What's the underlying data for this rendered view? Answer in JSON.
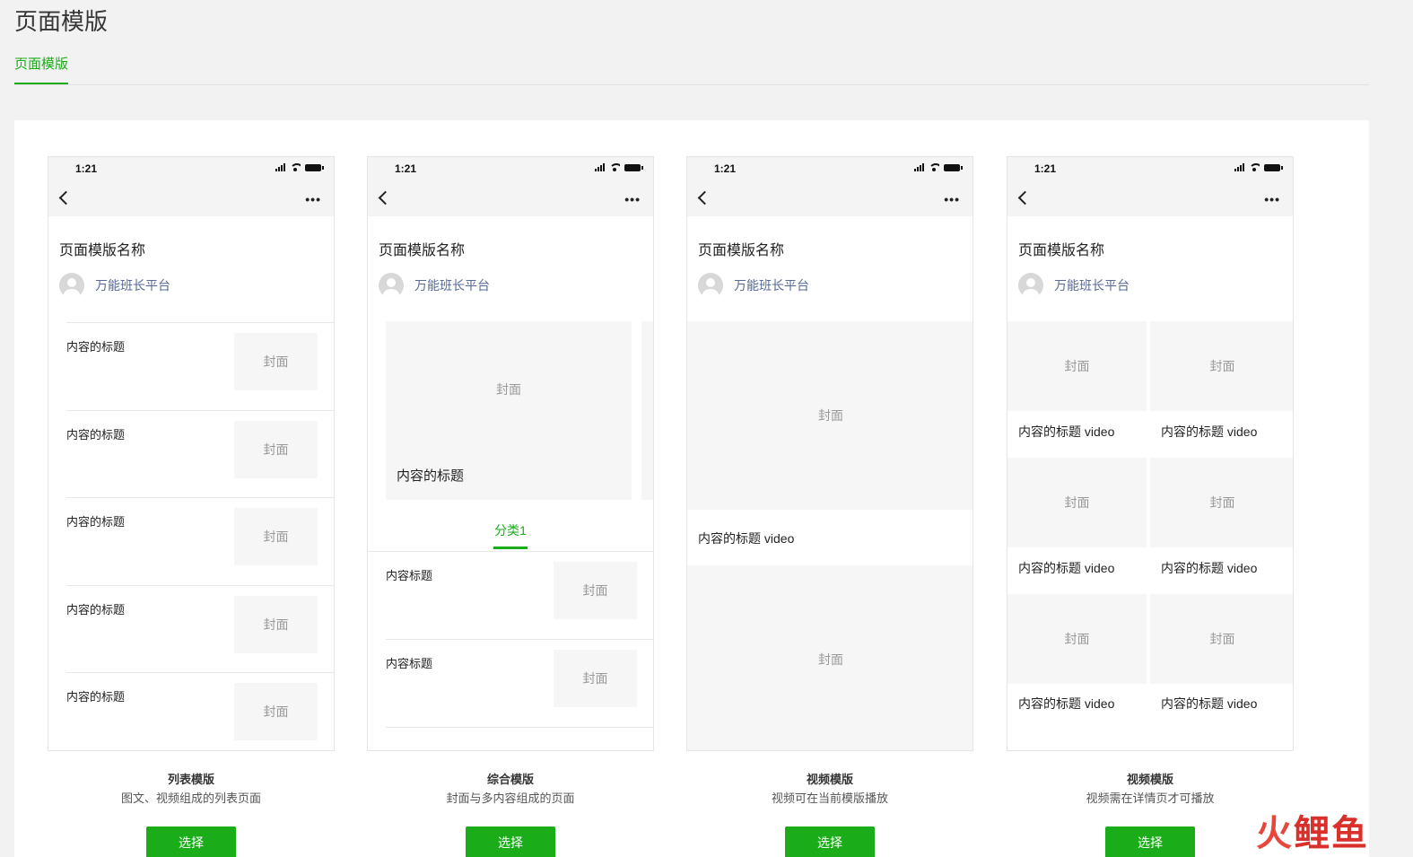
{
  "header": {
    "title": "页面模版"
  },
  "tabs": [
    {
      "label": "页面模版",
      "active": true
    }
  ],
  "colors": {
    "accent": "#1aad19",
    "link": "#576b95"
  },
  "phone": {
    "time": "1:21",
    "article_title": "页面模版名称",
    "author": "万能班长平台",
    "cover": "封面"
  },
  "templates": [
    {
      "caption_title": "列表模版",
      "caption_desc": "图文、视频组成的列表页面",
      "button": "选择",
      "items": [
        "内容的标题",
        "内容的标题",
        "内容的标题",
        "内容的标题",
        "内容的标题"
      ]
    },
    {
      "caption_title": "综合模版",
      "caption_desc": "封面与多内容组成的页面",
      "button": "选择",
      "hero_title": "内容的标题",
      "category_tab": "分类1",
      "items": [
        "内容标题",
        "内容标题"
      ]
    },
    {
      "caption_title": "视频模版",
      "caption_desc": "视频可在当前模版播放",
      "button": "选择",
      "video_title": "内容的标题 video"
    },
    {
      "caption_title": "视频模版",
      "caption_desc": "视频需在详情页才可播放",
      "button": "选择",
      "grid_items": [
        "内容的标题 video",
        "内容的标题 video",
        "内容的标题 video",
        "内容的标题 video",
        "内容的标题 video",
        "内容的标题 video"
      ]
    }
  ],
  "watermark": {
    "chars": [
      "火",
      "鲤",
      "鱼"
    ]
  }
}
